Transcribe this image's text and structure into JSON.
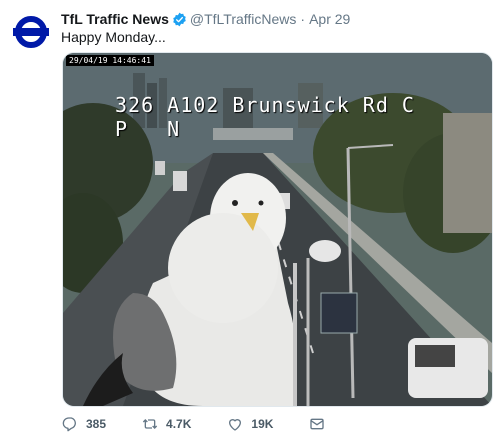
{
  "tweet": {
    "author_name": "TfL Traffic News",
    "handle": "@TfLTrafficNews",
    "separator": "·",
    "date": "Apr 29",
    "text": "Happy Monday..."
  },
  "media": {
    "timestamp": "29/04/19 14:46:41",
    "camera_line1": "326 A102 Brunswick Rd C",
    "camera_line2": "P   N"
  },
  "actions": {
    "replies": "385",
    "retweets": "4.7K",
    "likes": "19K"
  },
  "colors": {
    "tfl_red": "#dc241f",
    "tfl_blue": "#0019a8",
    "verified_blue": "#1da1f2",
    "icon_gray": "#657786"
  },
  "icons": [
    "roundel-logo-icon",
    "verified-badge-icon",
    "reply-icon",
    "retweet-icon",
    "like-icon",
    "dm-icon"
  ]
}
